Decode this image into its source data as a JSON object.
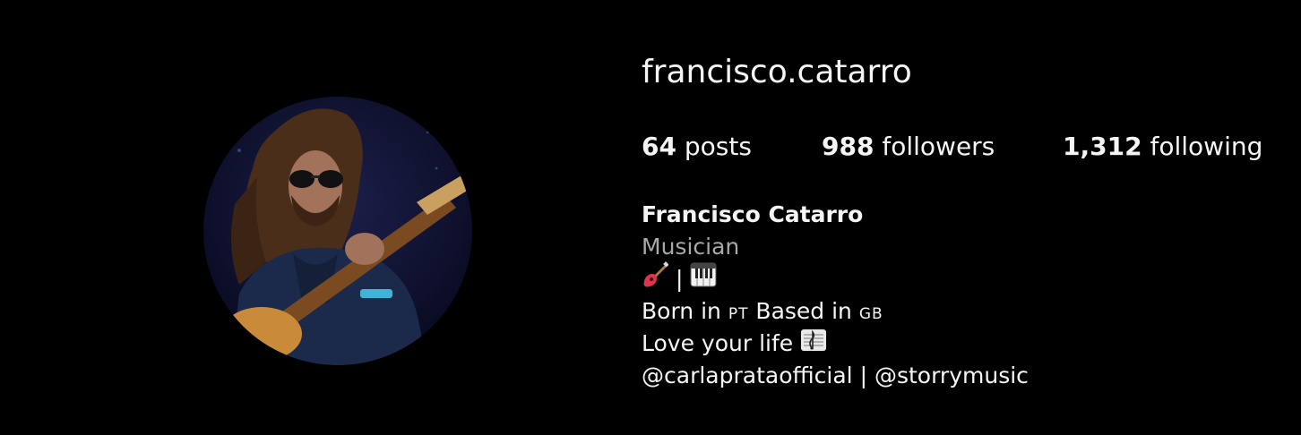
{
  "profile": {
    "username": "francisco.catarro",
    "stats": {
      "posts_count": "64",
      "posts_label": "posts",
      "followers_count": "988",
      "followers_label": "followers",
      "following_count": "1,312",
      "following_label": "following"
    },
    "bio": {
      "full_name": "Francisco Catarro",
      "category": "Musician",
      "emoji_line": {
        "icons": [
          "guitar-emoji",
          "piano-keyboard-emoji"
        ],
        "separator": "|"
      },
      "origin_line": {
        "born_in": "Born in",
        "born_flag": "PT",
        "based_in": "Based in",
        "based_flag": "GB"
      },
      "motto_line": {
        "text": "Love your life",
        "icon": "musical-score-emoji"
      },
      "mentions": {
        "first": "@carlaprataofficial",
        "separator": "|",
        "second": "@storrymusic"
      }
    },
    "avatar": {
      "icon": "profile-photo-guitarist"
    }
  },
  "colors": {
    "background": "#000000",
    "primary_text": "#f5f5f5",
    "secondary_text": "#a8a8a8"
  }
}
